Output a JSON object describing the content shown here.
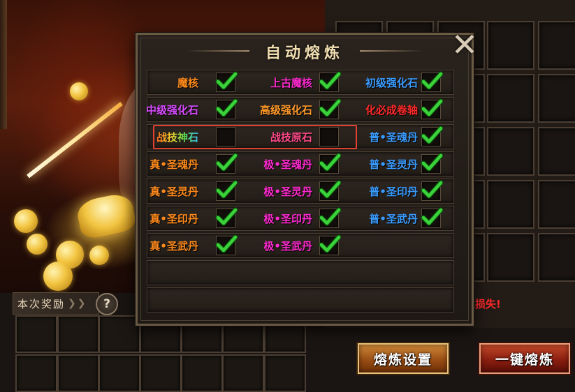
{
  "dialog": {
    "title": "自动熔炼"
  },
  "items": [
    {
      "label": "魔核",
      "color": "#ff8a1c",
      "checked": true
    },
    {
      "label": "上古魔核",
      "color": "#ff2ad0",
      "checked": true
    },
    {
      "label": "初级强化石",
      "color": "#3a9cff",
      "checked": true
    },
    {
      "label": "中级强化石",
      "color": "#d84cff",
      "checked": true
    },
    {
      "label": "高级强化石",
      "color": "#ff9a2a",
      "checked": true
    },
    {
      "label": "化必成卷轴",
      "color": "#ff2a2a",
      "checked": true
    },
    {
      "label": "战技神石",
      "color": "gradient",
      "checked": false
    },
    {
      "label": "战技原石",
      "color": "#ff4a8a",
      "checked": false
    },
    {
      "label": "普•圣魂丹",
      "color": "#3a9cff",
      "checked": true
    },
    {
      "label": "真•圣魂丹",
      "color": "#ff8a1c",
      "checked": true
    },
    {
      "label": "极•圣魂丹",
      "color": "#ff2ad0",
      "checked": true
    },
    {
      "label": "普•圣灵丹",
      "color": "#3a9cff",
      "checked": true
    },
    {
      "label": "真•圣灵丹",
      "color": "#ff8a1c",
      "checked": true
    },
    {
      "label": "极•圣灵丹",
      "color": "#ff2ad0",
      "checked": true
    },
    {
      "label": "普•圣印丹",
      "color": "#3a9cff",
      "checked": true
    },
    {
      "label": "真•圣印丹",
      "color": "#ff8a1c",
      "checked": true
    },
    {
      "label": "极•圣印丹",
      "color": "#ff2ad0",
      "checked": true
    },
    {
      "label": "普•圣武丹",
      "color": "#3a9cff",
      "checked": true
    },
    {
      "label": "真•圣武丹",
      "color": "#ff8a1c",
      "checked": true
    },
    {
      "label": "极•圣武丹",
      "color": "#ff2ad0",
      "checked": true
    }
  ],
  "reward": {
    "label": "本次奖励",
    "help": "?"
  },
  "warning": "免损失!",
  "buttons": {
    "settings": "熔炼设置",
    "one_key": "一键熔炼"
  },
  "icons": {
    "close": "close-icon",
    "check": "checkmark-icon",
    "help": "help-icon",
    "chevron": "double-chevron-icon"
  },
  "colors": {
    "check_green": "#3cd23c",
    "highlight_red": "#e04030"
  }
}
